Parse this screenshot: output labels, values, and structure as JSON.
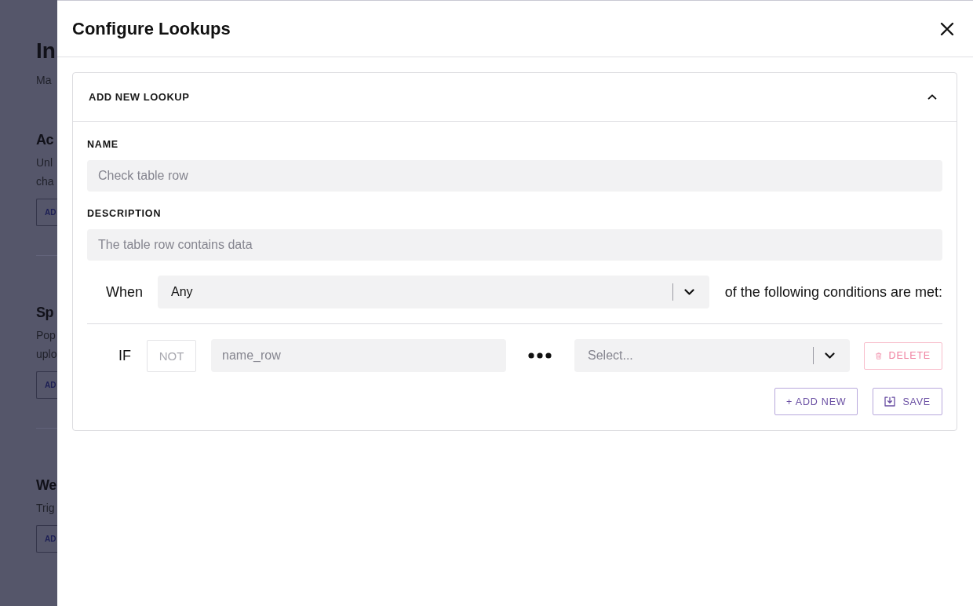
{
  "page": {
    "title": "In",
    "subtitle": "Ma",
    "sections": [
      {
        "heading": "Ac",
        "description": [
          "Unl",
          "cha"
        ],
        "button": "AD"
      },
      {
        "heading": "Sp",
        "description": [
          "Pop",
          "uplo"
        ],
        "button": "AD"
      },
      {
        "heading": "We",
        "description": [
          "Trig"
        ],
        "button": "AD"
      }
    ]
  },
  "dialog": {
    "title": "Configure Lookups"
  },
  "lookup_panel": {
    "title": "ADD NEW LOOKUP",
    "expanded": true,
    "fields": [
      {
        "label": "NAME",
        "placeholder": "Check table row"
      },
      {
        "label": "DESCRIPTION",
        "placeholder": "The table row contains data"
      }
    ],
    "match": {
      "label": "When",
      "value": "Any",
      "suffix": "of the following conditions are met:"
    },
    "conditions": [
      {
        "label": "IF",
        "not_toggle": {
          "label": "NOT",
          "selected": false
        },
        "field": {
          "placeholder": "name_row"
        },
        "operator": {
          "placeholder": "Select..."
        },
        "delete_button": {
          "label": "DELETE"
        }
      }
    ],
    "buttons": [
      {
        "label": "+ ADD NEW",
        "kind": "add"
      },
      {
        "label": "SAVE",
        "kind": "save"
      }
    ]
  }
}
